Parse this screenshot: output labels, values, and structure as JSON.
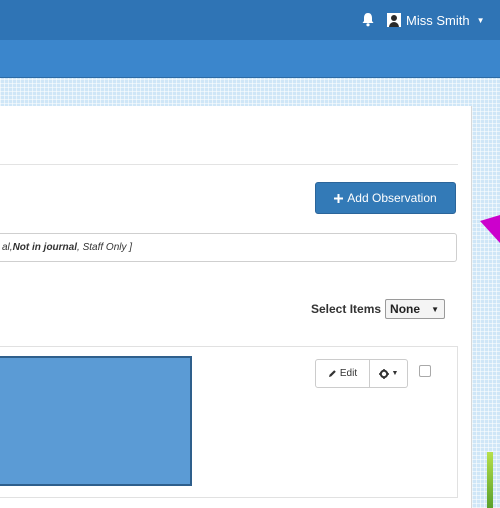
{
  "header": {
    "user_name": "Miss Smith",
    "notification_icon": "bell-icon",
    "avatar_icon": "user-icon",
    "menu_caret": "▼"
  },
  "toolbar": {
    "add_label": "Add Observation",
    "add_icon": "plus-icon",
    "add_color": "#337ab7"
  },
  "filter": {
    "text_start": "al, ",
    "text_bold": "Not in journal",
    "text_end": ", Staff Only ]"
  },
  "selection": {
    "label": "Select Items",
    "value": "None",
    "caret": "▼"
  },
  "observation": {
    "edit_label": "Edit",
    "edit_icon": "pencil-icon",
    "settings_icon": "gear-icon",
    "settings_caret": "▼",
    "image_color": "#5b9bd5"
  },
  "colors": {
    "top_bar": "#2f74b5",
    "nav_bar": "#3b86cc",
    "pointer": "#cc00cc"
  }
}
